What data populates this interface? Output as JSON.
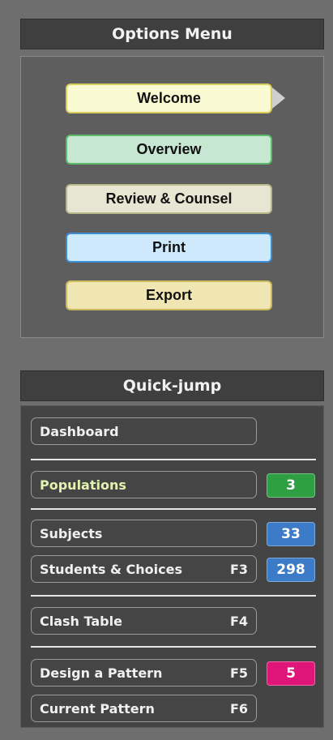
{
  "options_menu": {
    "title": "Options Menu",
    "items": [
      {
        "label": "Welcome",
        "color": "#fafad2",
        "border": "#d8cf5a"
      },
      {
        "label": "Overview",
        "color": "#c6e7d2",
        "border": "#5dbb6a"
      },
      {
        "label": "Review & Counsel",
        "color": "#e6e6d2",
        "border": "#b7b78a"
      },
      {
        "label": "Print",
        "color": "#cde9fb",
        "border": "#3a8fd6"
      },
      {
        "label": "Export",
        "color": "#f0e6b4",
        "border": "#c9b85c"
      }
    ]
  },
  "quick_jump": {
    "title": "Quick-jump",
    "items": [
      {
        "label": "Dashboard",
        "key": "",
        "badge": ""
      },
      {
        "label": "Populations",
        "key": "",
        "badge": "3",
        "badge_color": "#2ea043"
      },
      {
        "label": "Subjects",
        "key": "",
        "badge": "33",
        "badge_color": "#3b7bc8"
      },
      {
        "label": "Students & Choices",
        "key": "F3",
        "badge": "298",
        "badge_color": "#3b7bc8"
      },
      {
        "label": "Clash Table",
        "key": "F4",
        "badge": ""
      },
      {
        "label": "Design a Pattern",
        "key": "F5",
        "badge": "5",
        "badge_color": "#e0157a"
      },
      {
        "label": "Current Pattern",
        "key": "F6",
        "badge": ""
      }
    ]
  }
}
